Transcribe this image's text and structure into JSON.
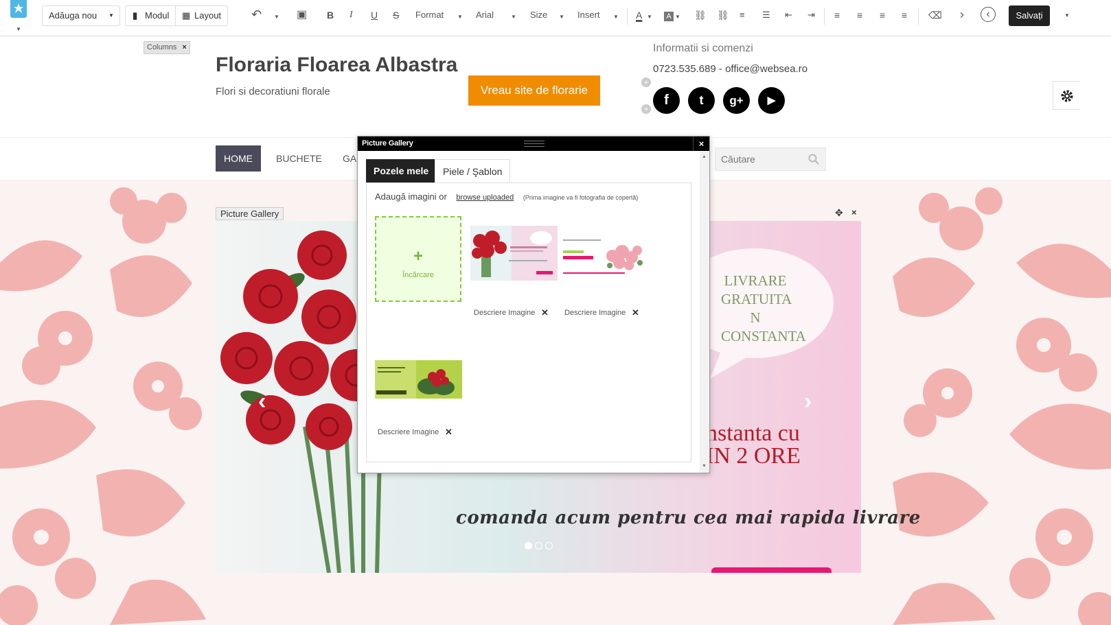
{
  "toolbar": {
    "add_new": "Adăuga nou",
    "module": "Modul",
    "layout": "Layout",
    "format": "Format",
    "font": "Arial",
    "size": "Size",
    "insert": "Insert",
    "save": "Salvați"
  },
  "header": {
    "columns_tag": "Columns",
    "columns_close": "×",
    "site_title": "Floraria Floarea Albastra",
    "site_subtitle": "Flori si decoratiuni florale",
    "cta": "Vreau site de florarie",
    "info_title": "Informatii si comenzi",
    "info_contact": "0723.535.689  -  office@websea.ro",
    "social": [
      {
        "icon": "facebook-icon",
        "glyph": "f"
      },
      {
        "icon": "twitter-icon",
        "glyph": "t"
      },
      {
        "icon": "google-plus-icon",
        "glyph": "g+"
      },
      {
        "icon": "youtube-icon",
        "glyph": "▶"
      }
    ]
  },
  "nav": {
    "items": [
      "HOME",
      "BUCHETE",
      "GA"
    ],
    "active_index": 0,
    "search_placeholder": "Căutare"
  },
  "slider": {
    "tag": "Picture Gallery",
    "banner_lines": [
      "LIVRARE",
      "GRATUITA",
      "N CONSTANTA"
    ],
    "banner_bottom": [
      "nstanta cu",
      "IN 2 ORE"
    ],
    "caption": "comanda acum pentru cea mai rapida livrare",
    "dot_count": 3,
    "active_dot": 0
  },
  "modal": {
    "title": "Picture Gallery",
    "close": "×",
    "tabs": [
      "Pozele mele",
      "Piele / Şablon"
    ],
    "active_tab": 0,
    "add_text": "Adaugă imagini or",
    "browse_link": "browse uploaded",
    "note": "(Prima imagine va fi fotografia de copertă)",
    "upload_plus": "+",
    "upload_label": "Încărcare",
    "images": [
      {
        "description": "Descriere Imagine"
      },
      {
        "description": "Descriere Imagine"
      },
      {
        "description": "Descriere Imagine"
      }
    ]
  },
  "colors": {
    "accent_orange": "#f08c00",
    "nav_active": "#4a4a5a",
    "upload_green": "#8ac640",
    "floral_pink": "#f2b3b0"
  }
}
